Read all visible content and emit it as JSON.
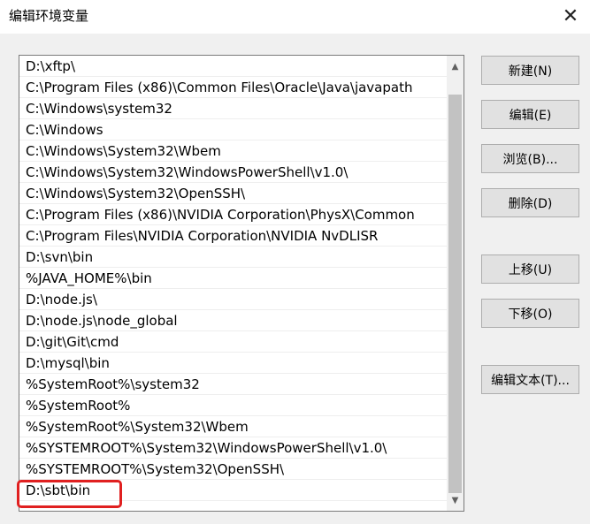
{
  "window": {
    "title": "编辑环境变量",
    "close_glyph": "✕"
  },
  "path_list": {
    "items": [
      "D:\\xftp\\",
      "C:\\Program Files (x86)\\Common Files\\Oracle\\Java\\javapath",
      "C:\\Windows\\system32",
      "C:\\Windows",
      "C:\\Windows\\System32\\Wbem",
      "C:\\Windows\\System32\\WindowsPowerShell\\v1.0\\",
      "C:\\Windows\\System32\\OpenSSH\\",
      "C:\\Program Files (x86)\\NVIDIA Corporation\\PhysX\\Common",
      "C:\\Program Files\\NVIDIA Corporation\\NVIDIA NvDLISR",
      "D:\\svn\\bin",
      "%JAVA_HOME%\\bin",
      "D:\\node.js\\",
      "D:\\node.js\\node_global",
      "D:\\git\\Git\\cmd",
      "D:\\mysql\\bin",
      "%SystemRoot%\\system32",
      "%SystemRoot%",
      "%SystemRoot%\\System32\\Wbem",
      "%SYSTEMROOT%\\System32\\WindowsPowerShell\\v1.0\\",
      "%SYSTEMROOT%\\System32\\OpenSSH\\",
      "D:\\sbt\\bin"
    ],
    "scroll_up_glyph": "▲",
    "scroll_down_glyph": "▼"
  },
  "buttons": {
    "new": "新建(N)",
    "edit": "编辑(E)",
    "browse": "浏览(B)...",
    "delete": "删除(D)",
    "move_up": "上移(U)",
    "move_down": "下移(O)",
    "edit_text": "编辑文本(T)..."
  },
  "colors": {
    "highlight_border": "#e02020",
    "window_bg": "#f0f0f0",
    "button_bg": "#e1e1e1"
  }
}
